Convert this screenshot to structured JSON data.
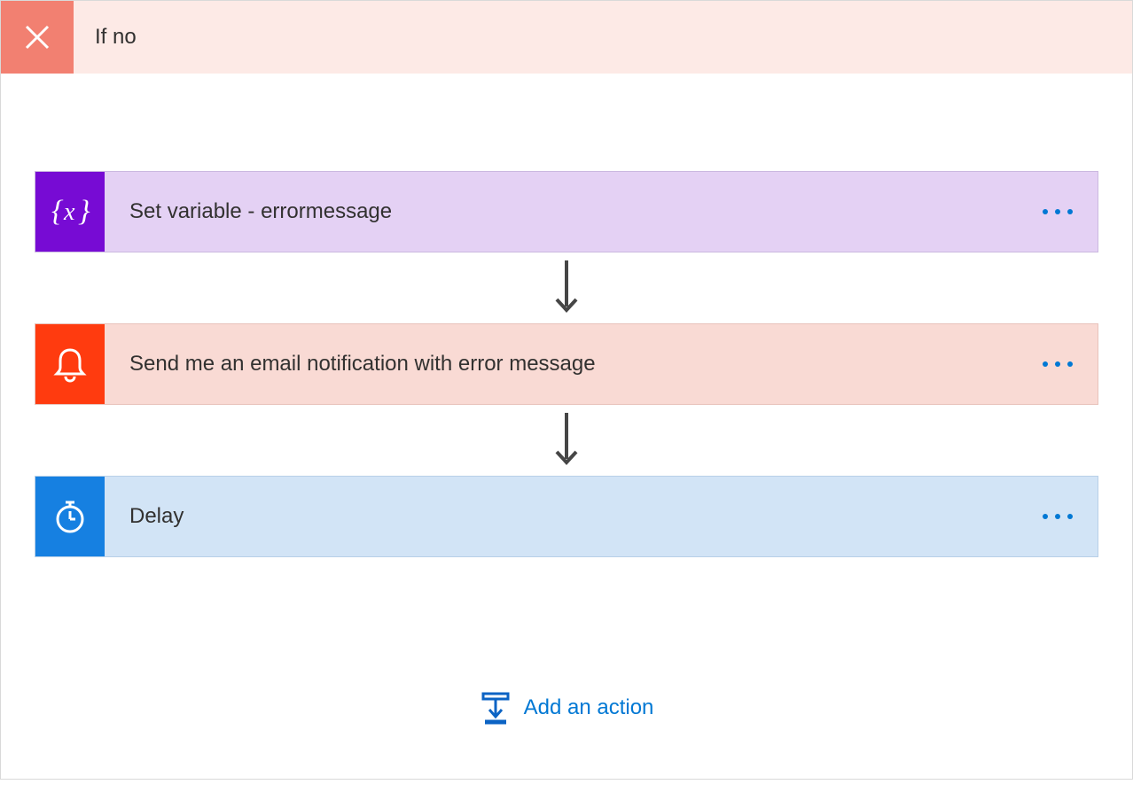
{
  "branch": {
    "title": "If no"
  },
  "actions": [
    {
      "id": "set-variable",
      "label": "Set variable - errormessage",
      "icon": "variable-icon",
      "style": "card-variable"
    },
    {
      "id": "send-notification",
      "label": "Send me an email notification with error message",
      "icon": "bell-icon",
      "style": "card-notification"
    },
    {
      "id": "delay",
      "label": "Delay",
      "icon": "timer-icon",
      "style": "card-delay"
    }
  ],
  "addAction": {
    "label": "Add an action"
  }
}
